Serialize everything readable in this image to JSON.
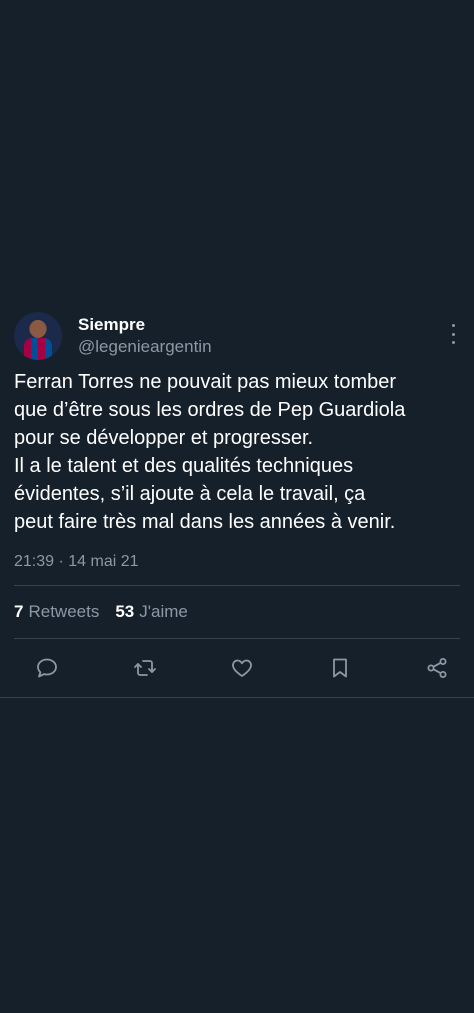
{
  "tweet": {
    "author": {
      "display_name": "Siempre",
      "handle": "@legenieargentin"
    },
    "text_lines": [
      "Ferran Torres ne pouvait pas mieux tomber",
      "que d’être sous les ordres de Pep Guardiola",
      "pour se développer et progresser.",
      "Il a le talent et des qualités techniques",
      "évidentes, s’il ajoute à cela le travail, ça",
      "peut faire très mal dans les années à venir."
    ],
    "timestamp": "21:39 · 14 mai 21",
    "stats": {
      "retweets_count": "7",
      "retweets_label": "Retweets",
      "likes_count": "53",
      "likes_label": "J'aime"
    },
    "icons": {
      "more": "more-vertical-icon",
      "reply": "reply-icon",
      "retweet": "retweet-icon",
      "like": "heart-icon",
      "bookmark": "bookmark-icon",
      "share": "share-icon"
    }
  },
  "colors": {
    "background": "#15202b",
    "text_primary": "#ffffff",
    "text_secondary": "#8b98a5",
    "divider": "#38444d"
  }
}
